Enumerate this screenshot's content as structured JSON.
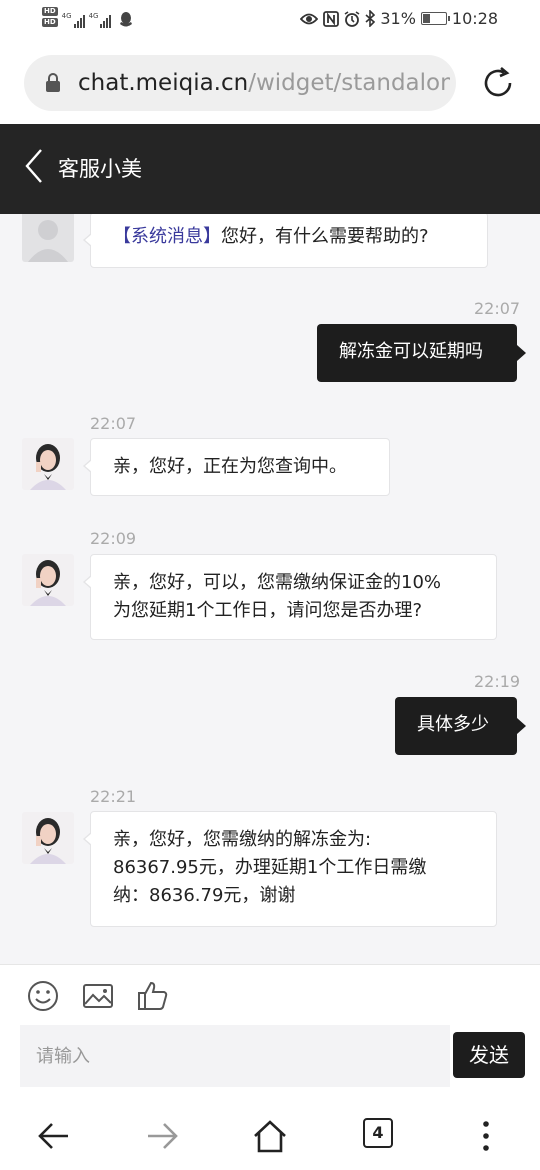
{
  "status_bar": {
    "hd_badge_1": "HD",
    "hd_badge_2": "HD",
    "network_1": "4G",
    "network_2": "4G",
    "battery_percent": "31%",
    "battery_level": 0.31,
    "time": "10:28"
  },
  "browser": {
    "url_host": "chat.meiqia.cn",
    "url_path": "/widget/standalone",
    "tab_count": "4"
  },
  "header": {
    "title": "客服小美"
  },
  "messages": [
    {
      "from": "agent",
      "avatar": "blank",
      "text_bracket": "【系统消息】",
      "text": "您好，有什么需要帮助的?"
    },
    {
      "from": "user",
      "time": "22:07",
      "text": "解冻金可以延期吗"
    },
    {
      "from": "agent",
      "avatar": "photo",
      "time": "22:07",
      "text": "亲，您好，正在为您查询中。"
    },
    {
      "from": "agent",
      "avatar": "photo",
      "time": "22:09",
      "lines": [
        "亲，您好，可以，您需缴纳保证金的10%",
        "为您延期1个工作日，请问您是否办理?"
      ]
    },
    {
      "from": "user",
      "time": "22:19",
      "text": "具体多少"
    },
    {
      "from": "agent",
      "avatar": "photo",
      "time": "22:21",
      "lines": [
        "亲，您好，您需缴纳的解冻金为:",
        "86367.95元，办理延期1个工作日需缴",
        "纳：8636.79元，谢谢"
      ]
    }
  ],
  "composer": {
    "placeholder": "请输入",
    "send_label": "发送"
  },
  "icons": {
    "emoji": "emoji-icon",
    "image": "image-icon",
    "thumbs_up": "thumbs-up-icon",
    "back": "back-arrow-icon",
    "forward": "forward-arrow-icon",
    "home": "home-icon",
    "tabs": "tabs-icon",
    "menu": "more-vert-icon"
  },
  "colors": {
    "header_bg": "#252525",
    "outgoing_bubble": "#1d1d1d",
    "chat_bg": "#f5f5f7",
    "system_bracket": "#3a3a9c"
  }
}
